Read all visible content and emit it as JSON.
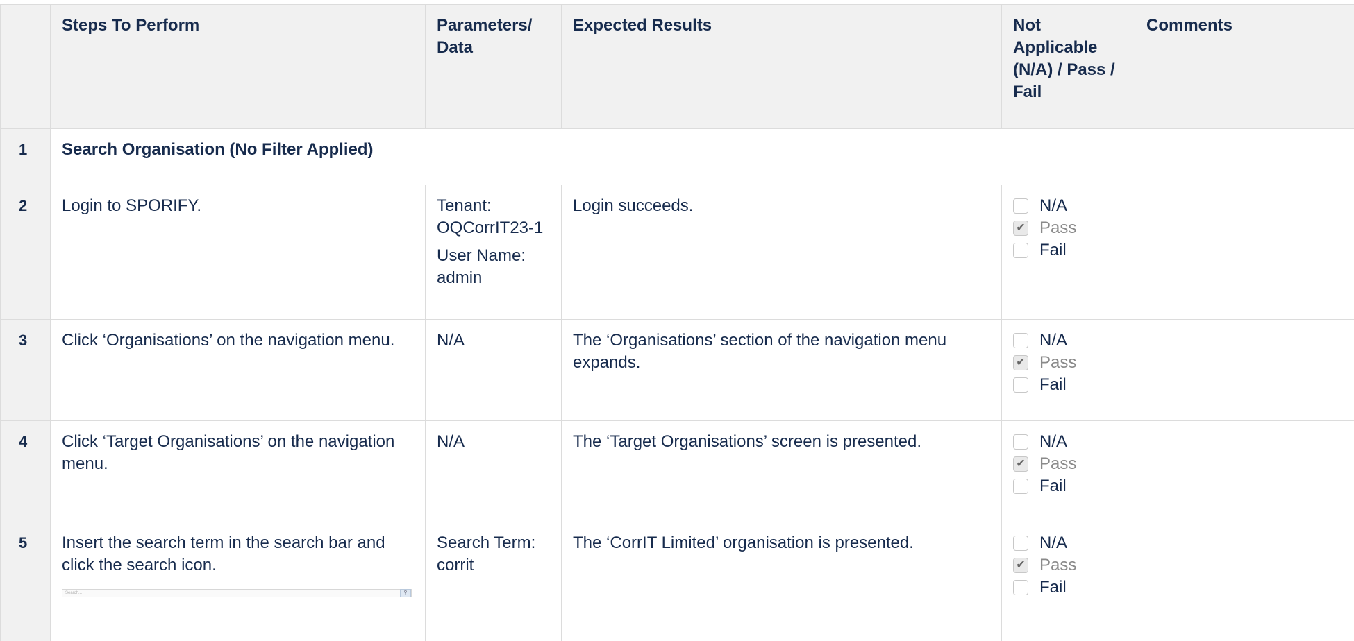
{
  "headers": {
    "steps": "Steps To Perform",
    "parameters": "Parameters/ Data",
    "expected": "Expected Results",
    "status": "Not Applicable (N/A) / Pass / Fail",
    "comments": "Comments"
  },
  "section": {
    "number": "1",
    "title": "Search Organisation (No Filter Applied)"
  },
  "status_options": {
    "na": "N/A",
    "pass": "Pass",
    "fail": "Fail"
  },
  "rows": [
    {
      "number": "2",
      "step": "Login to SPORIFY.",
      "params": [
        "Tenant: OQCorrIT23-1",
        "User Name: admin"
      ],
      "expected": "Login succeeds.",
      "checked": "pass"
    },
    {
      "number": "3",
      "step": "Click ‘Organisations’ on the navigation menu.",
      "params": [
        "N/A"
      ],
      "expected": "The ‘Organisations’ section of the navigation menu expands.",
      "checked": "pass"
    },
    {
      "number": "4",
      "step": "Click ‘Target Organisations’ on the navigation menu.",
      "params": [
        "N/A"
      ],
      "expected": "The ‘Target Organisations’ screen is presented.",
      "checked": "pass"
    },
    {
      "number": "5",
      "step": "Insert the search term in the search bar and click the search icon.",
      "params": [
        "Search Term: corrit"
      ],
      "expected": "The ‘CorrIT Limited’ organisation is presented.",
      "checked": "pass"
    }
  ],
  "search_mock": {
    "placeholder": "Search..."
  }
}
